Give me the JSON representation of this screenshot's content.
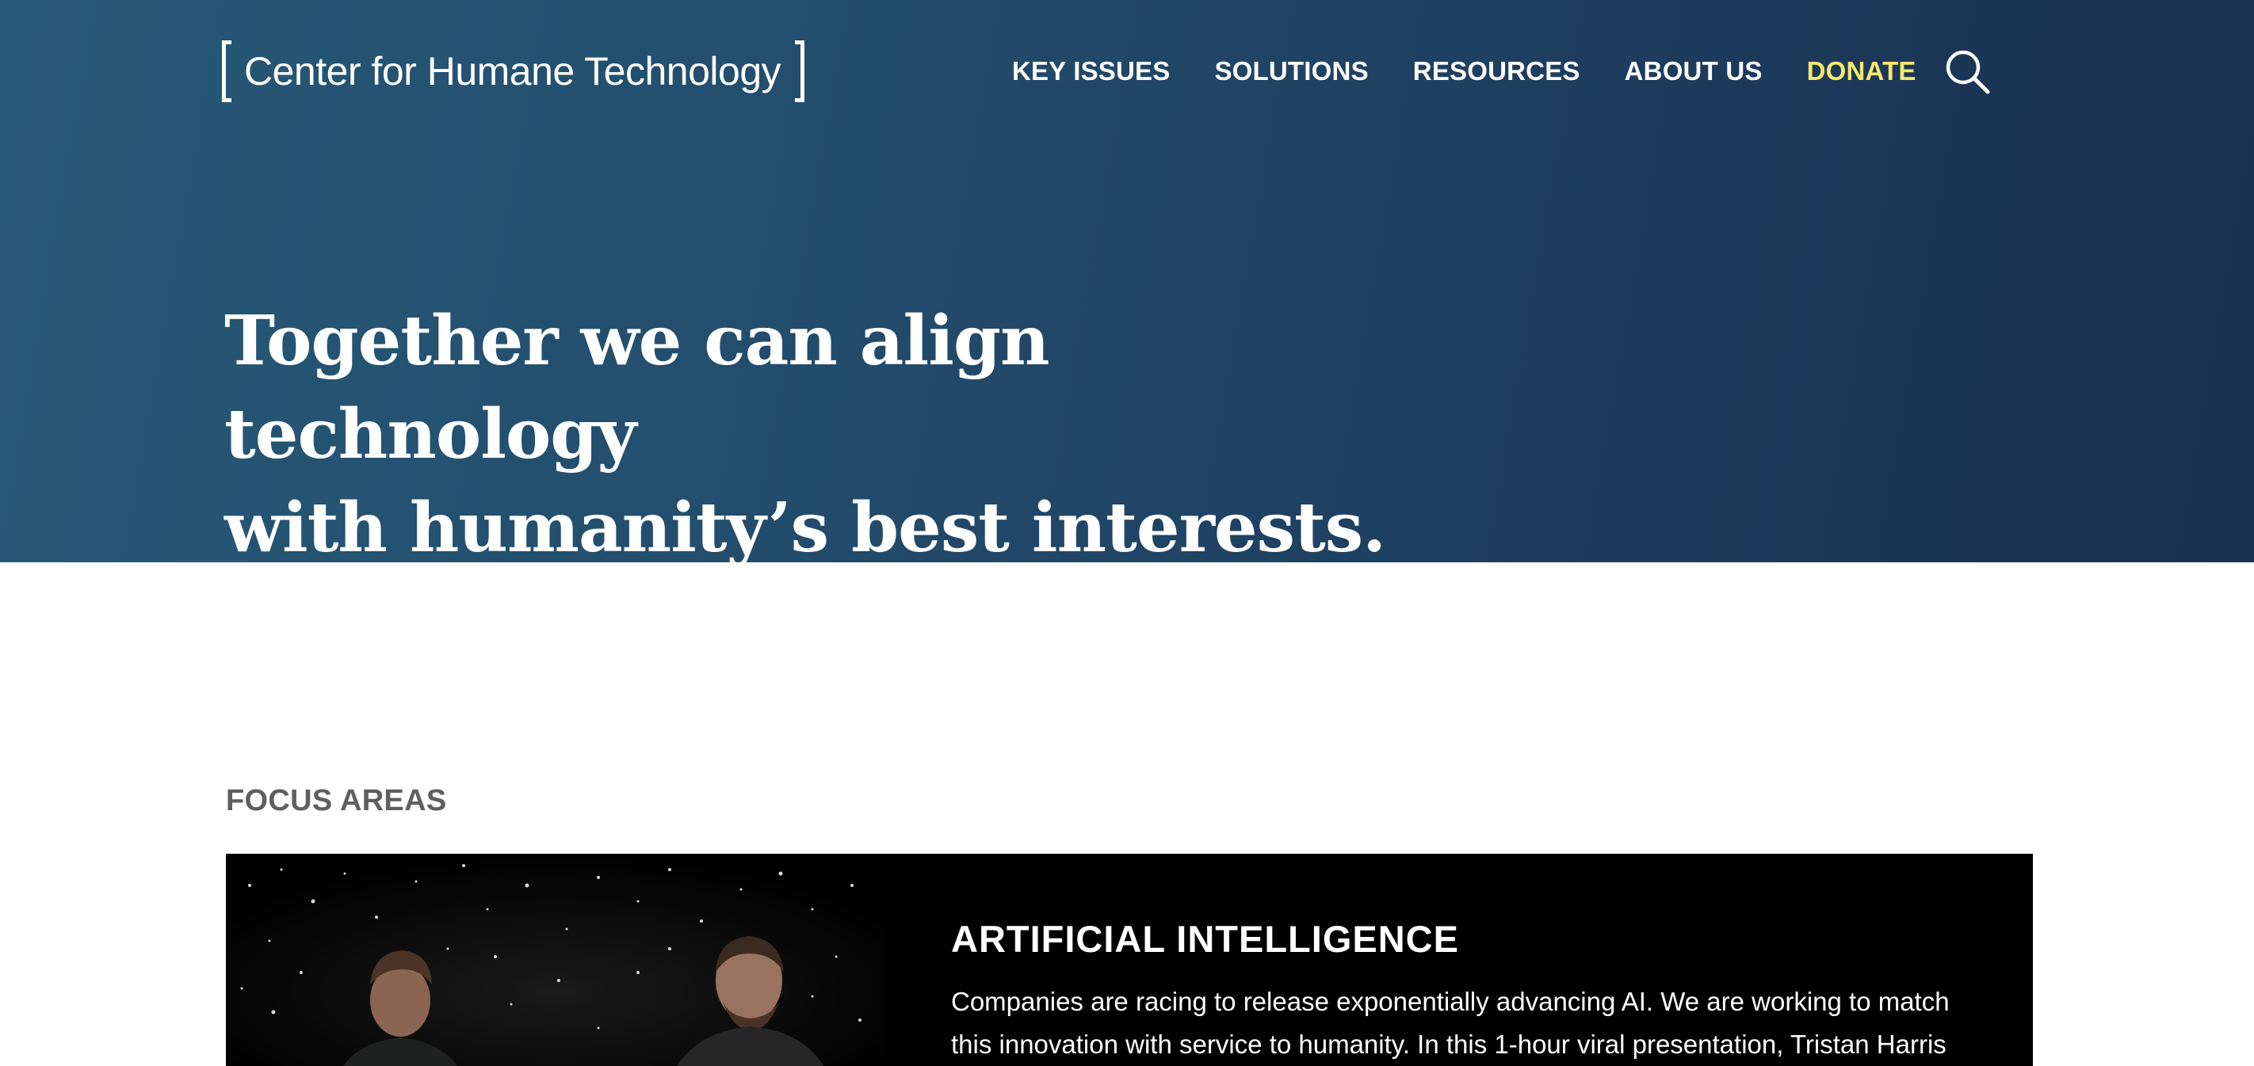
{
  "header": {
    "logo_text": "Center for Humane Technology",
    "nav": {
      "key_issues": "KEY ISSUES",
      "solutions": "SOLUTIONS",
      "resources": "RESOURCES",
      "about_us": "ABOUT US",
      "donate": "DONATE"
    },
    "search_icon": "search-icon"
  },
  "hero": {
    "headline_line1": "Together we can align technology",
    "headline_line2": "with humanity’s best interests."
  },
  "focus": {
    "section_label": "FOCUS AREAS",
    "card": {
      "title": "ARTIFICIAL INTELLIGENCE",
      "body_line1": "Companies are racing to release exponentially advancing AI. We are working to match",
      "body_line2": "this innovation with service to humanity. In this 1-hour viral presentation, Tristan Harris"
    }
  },
  "colors": {
    "hero_start": "#275a78",
    "hero_end": "#18304f",
    "donate": "#f5e96b",
    "section_label": "#5f5f5f",
    "card_bg": "#000000"
  }
}
